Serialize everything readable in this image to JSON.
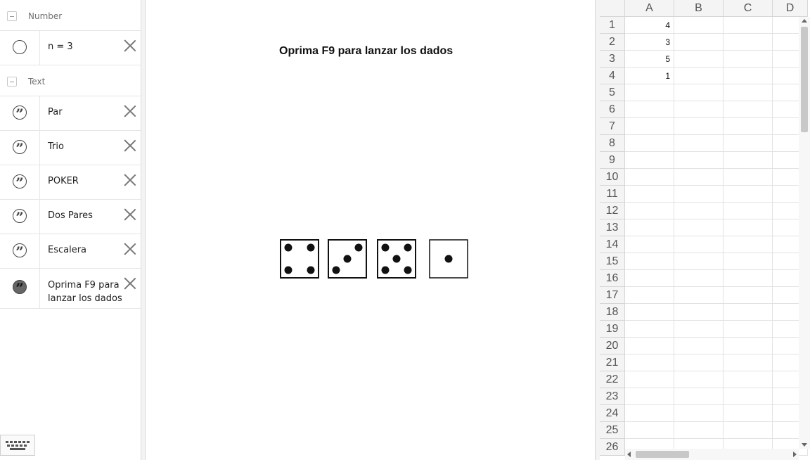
{
  "algebra": {
    "groups": [
      {
        "label": "Number",
        "items": [
          {
            "text": "n = 3",
            "marble": "empty"
          }
        ]
      },
      {
        "label": "Text",
        "items": [
          {
            "text": "Par",
            "marble": "quote"
          },
          {
            "text": "Trio",
            "marble": "quote"
          },
          {
            "text": "POKER",
            "marble": "quote"
          },
          {
            "text": "Dos Pares",
            "marble": "quote"
          },
          {
            "text": "Escalera",
            "marble": "quote"
          },
          {
            "text": "Oprima F9 para lanzar los dados",
            "marble": "quote-filled"
          }
        ]
      }
    ],
    "keyboard_icon": "keyboard-icon"
  },
  "graphics": {
    "text": "Oprima F9 para lanzar los dados",
    "dice": [
      4,
      3,
      5,
      1
    ]
  },
  "spreadsheet": {
    "columns": [
      "A",
      "B",
      "C",
      "D"
    ],
    "rows": [
      "1",
      "2",
      "3",
      "4",
      "5",
      "6",
      "7",
      "8",
      "9",
      "10",
      "11",
      "12",
      "13",
      "14",
      "15",
      "16",
      "17",
      "18",
      "19",
      "20",
      "21",
      "22",
      "23",
      "24",
      "25",
      "26"
    ],
    "cells": {
      "A1": "4",
      "A2": "3",
      "A3": "5",
      "A4": "1"
    }
  }
}
